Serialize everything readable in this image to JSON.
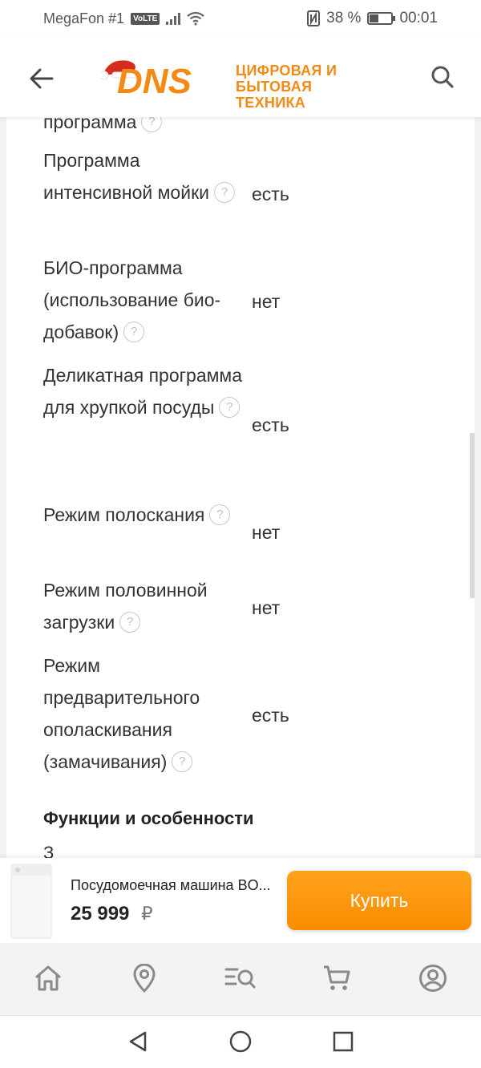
{
  "status_bar": {
    "carrier": "MegaFon #1",
    "volte": "VoLTE",
    "battery": "38 %",
    "time": "00:01",
    "battery_level": 0.38
  },
  "header": {
    "logo_text": "DNS",
    "logo_tagline_line1": "ЦИФРОВАЯ И",
    "logo_tagline_line2": "БЫТОВАЯ ТЕХНИКА",
    "brand_color": "#f28a15"
  },
  "specs": [
    {
      "name": "программа",
      "value": "",
      "help": "?"
    },
    {
      "name": "Программа интенсивной мойки",
      "value": "есть",
      "help": "?"
    },
    {
      "name": "БИО-программа (использование био-добавок)",
      "value": "нет",
      "help": "?"
    },
    {
      "name": "Деликатная программа для хрупкой посуды",
      "value": "есть",
      "help": "?"
    },
    {
      "name": "Режим полоскания",
      "value": "нет",
      "help": "?"
    },
    {
      "name": "Режим половинной загрузки",
      "value": "нет",
      "help": "?"
    },
    {
      "name": "Режим предварительного ополаскивания (замачивания)",
      "value": "есть",
      "help": "?"
    }
  ],
  "section": {
    "title": "Функции и особенности",
    "next_text": "З"
  },
  "buy_bar": {
    "product_name": "Посудомоечная машина BO...",
    "price": "25 999",
    "currency": "₽",
    "buy_label": "Купить",
    "accent": "#fb8c00"
  },
  "bottom_nav": {
    "icons": [
      "home-icon",
      "location-icon",
      "catalog-search-icon",
      "cart-icon",
      "profile-icon"
    ]
  },
  "system_nav": {
    "icons": [
      "back-triangle-icon",
      "home-circle-icon",
      "recents-square-icon"
    ]
  }
}
